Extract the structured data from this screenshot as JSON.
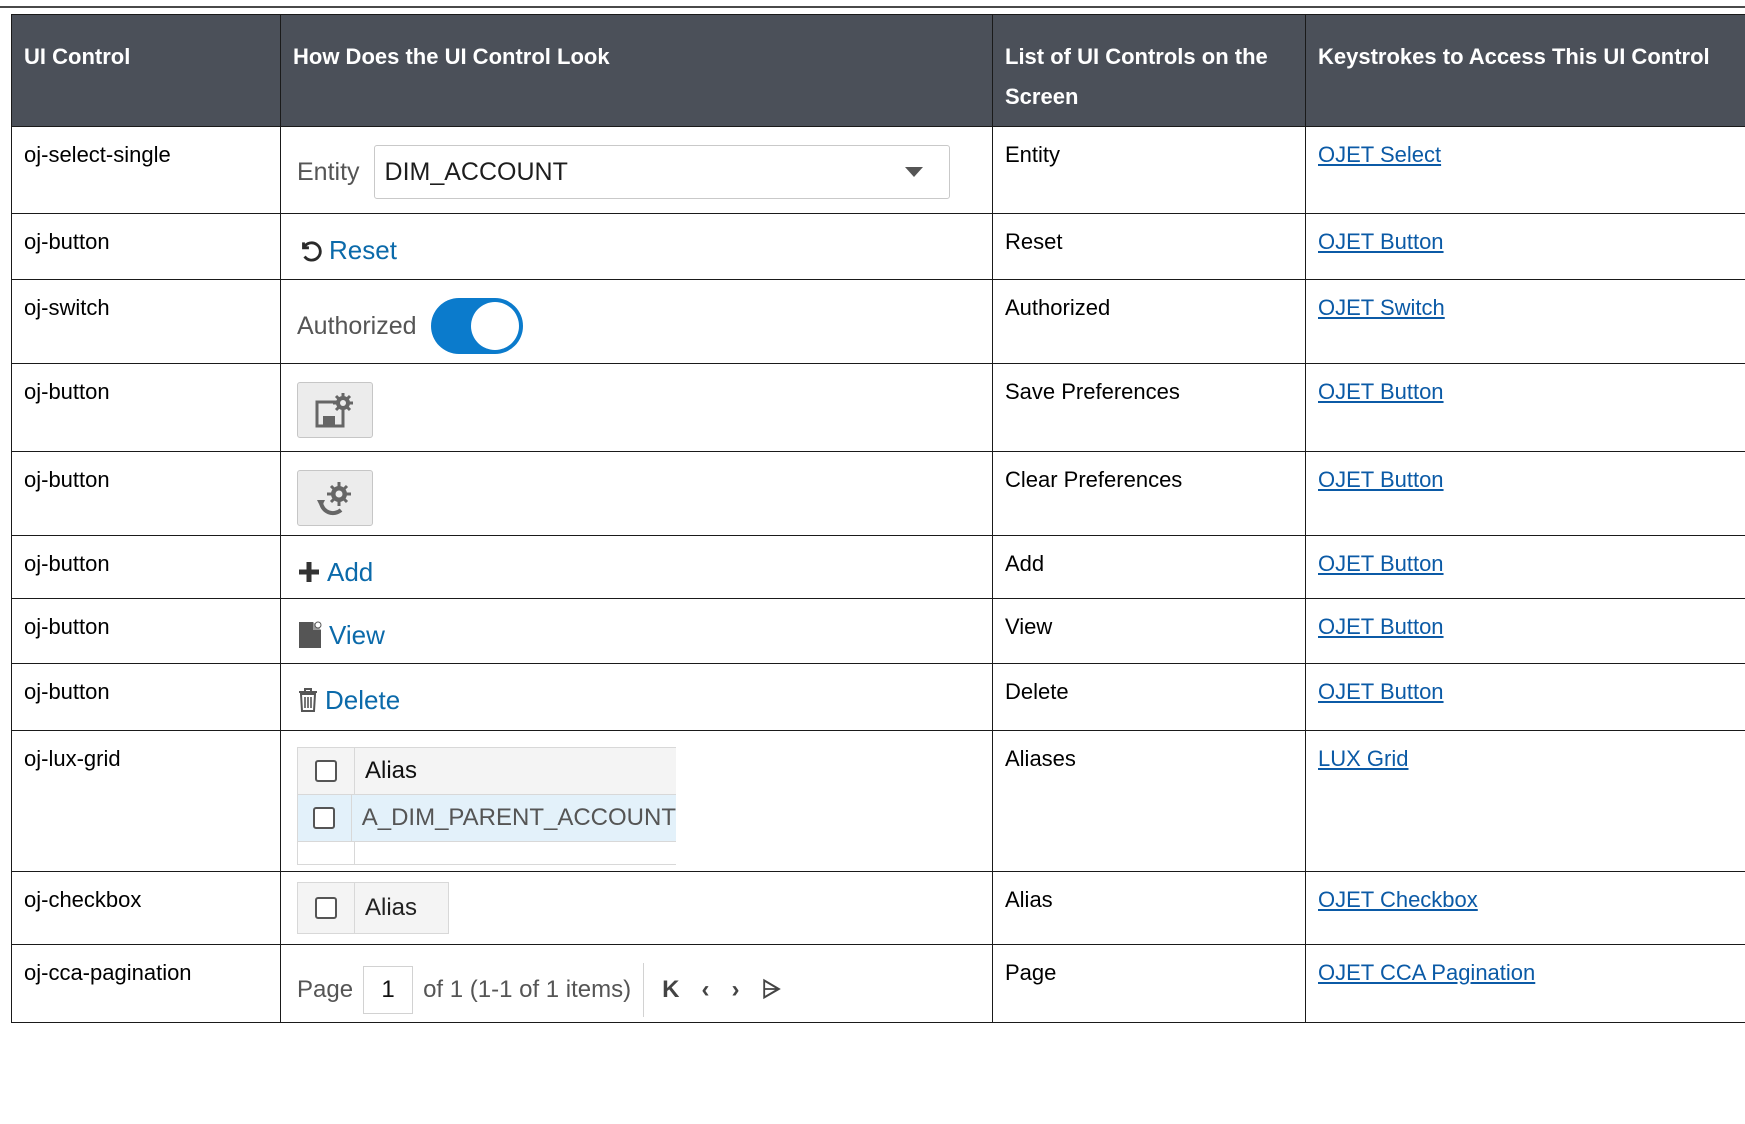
{
  "headers": [
    "UI Control",
    "How Does the UI Control Look",
    "List of UI Controls on the Screen",
    "Keystrokes to Access This UI Control"
  ],
  "rows": [
    {
      "control": "oj-select-single",
      "look": {
        "label": "Entity",
        "value": "DIM_ACCOUNT"
      },
      "list": "Entity",
      "link": "OJET Select"
    },
    {
      "control": "oj-button",
      "look": {
        "label": "Reset"
      },
      "list": "Reset",
      "link": "OJET Button"
    },
    {
      "control": "oj-switch",
      "look": {
        "label": "Authorized"
      },
      "list": "Authorized",
      "link": "OJET Switch"
    },
    {
      "control": "oj-button",
      "look": {},
      "list": "Save Preferences",
      "link": "OJET Button"
    },
    {
      "control": "oj-button",
      "look": {},
      "list": "Clear Preferences",
      "link": "OJET Button"
    },
    {
      "control": "oj-button",
      "look": {
        "label": "Add"
      },
      "list": "Add",
      "link": "OJET Button"
    },
    {
      "control": "oj-button",
      "look": {
        "label": "View"
      },
      "list": "View",
      "link": "OJET Button"
    },
    {
      "control": "oj-button",
      "look": {
        "label": "Delete"
      },
      "list": "Delete",
      "link": "OJET Button"
    },
    {
      "control": "oj-lux-grid",
      "look": {
        "header": "Alias",
        "row": "A_DIM_PARENT_ACCOUNT"
      },
      "list": "Aliases",
      "link": "LUX Grid"
    },
    {
      "control": "oj-checkbox",
      "look": {
        "label": "Alias"
      },
      "list": "Alias",
      "link": "OJET Checkbox"
    },
    {
      "control": "oj-cca-pagination",
      "look": {
        "label": "Page",
        "page": "1",
        "summary": "of 1 (1-1 of 1 items)"
      },
      "list": "Page",
      "link": "OJET CCA Pagination"
    }
  ],
  "colors": {
    "header_bg": "#4b5059",
    "link": "#0b5aa6",
    "accent": "#0b7bcc"
  }
}
